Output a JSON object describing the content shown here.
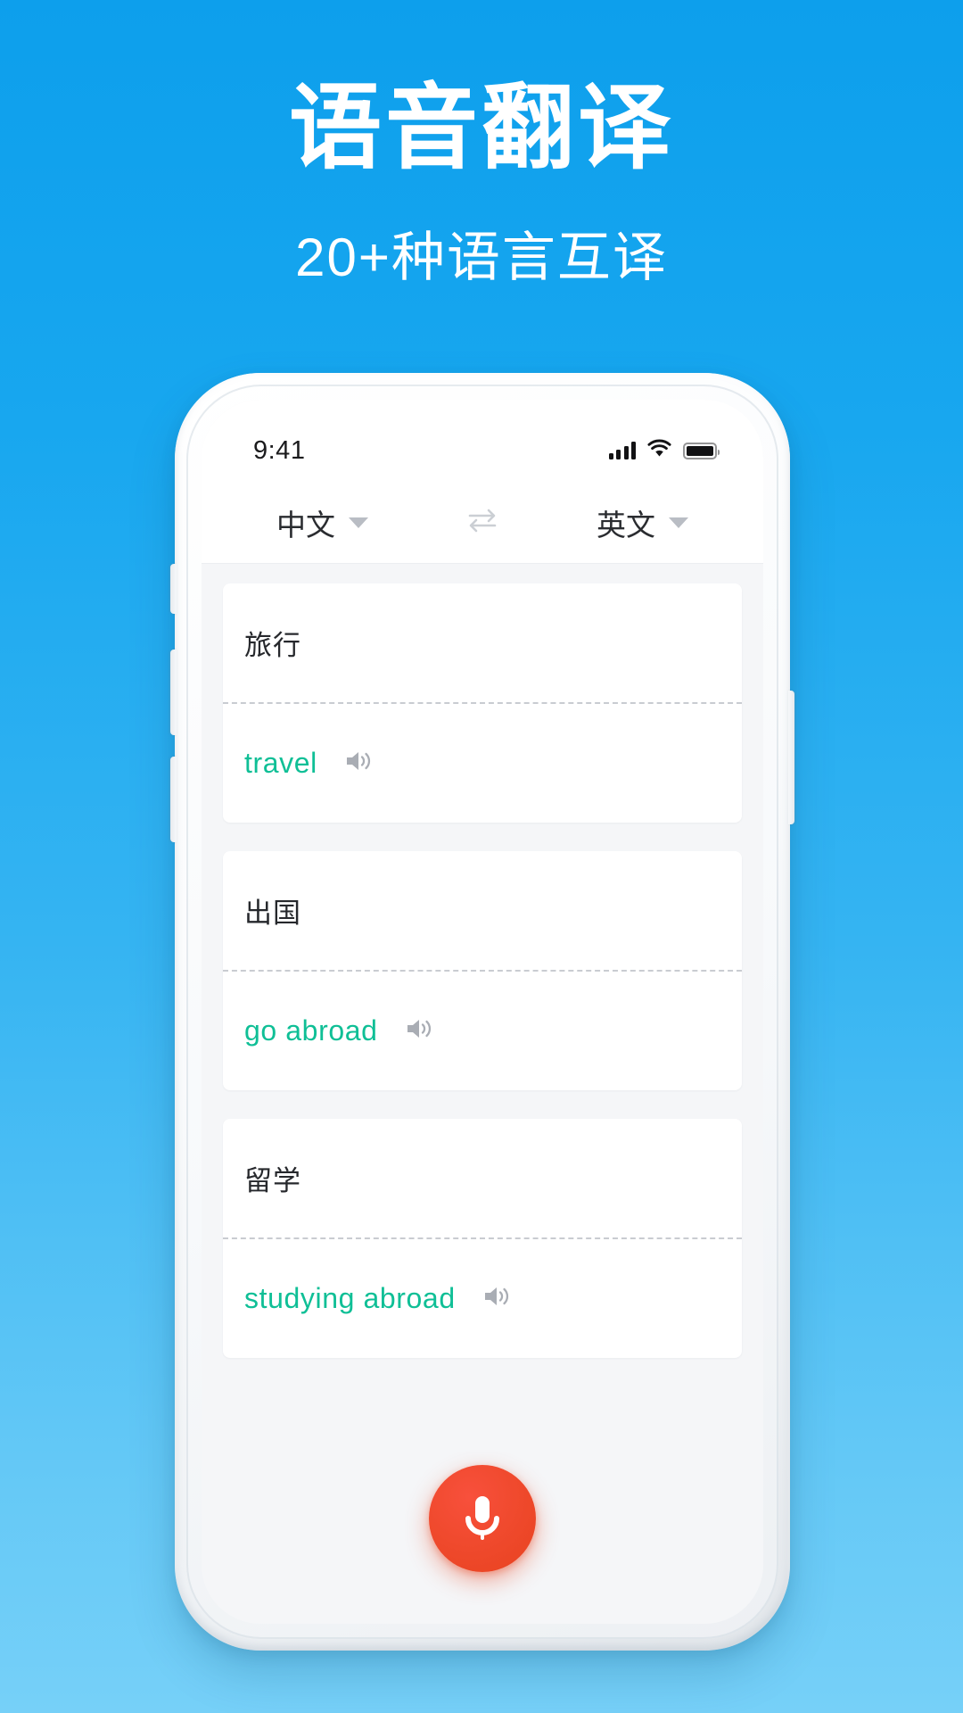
{
  "hero": {
    "title": "语音翻译",
    "subtitle": "20+种语言互译"
  },
  "colors": {
    "background_top": "#0d9fec",
    "background_bottom": "#76d0f8",
    "translation_text": "#0fbf96",
    "mic_button": "#e8421f",
    "source_text": "#26282c"
  },
  "phone": {
    "statusbar": {
      "time": "9:41",
      "signal_icon": "signal-bars-icon",
      "wifi_icon": "wifi-icon",
      "battery_icon": "battery-full-icon"
    },
    "language_bar": {
      "source_language": "中文",
      "target_language": "英文",
      "swap_icon": "swap-arrows-icon",
      "caret_icon": "chevron-down-icon"
    },
    "cards": [
      {
        "source": "旅行",
        "target": "travel",
        "speaker_icon": "speaker-icon"
      },
      {
        "source": "出国",
        "target": "go abroad",
        "speaker_icon": "speaker-icon"
      },
      {
        "source": "留学",
        "target": "studying abroad",
        "speaker_icon": "speaker-icon"
      }
    ],
    "mic_button": {
      "icon": "microphone-icon"
    }
  }
}
